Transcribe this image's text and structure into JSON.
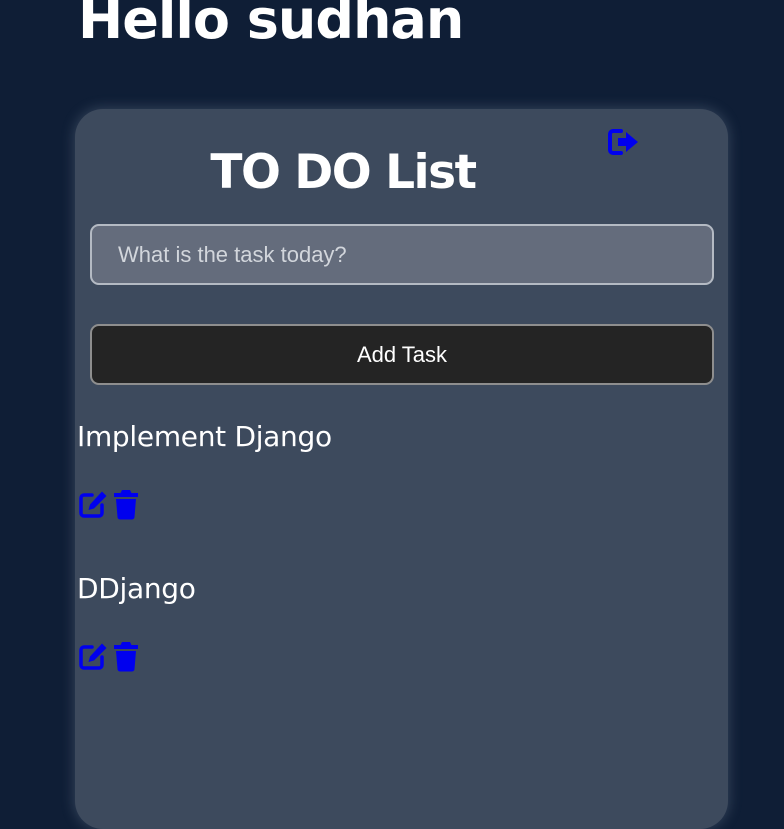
{
  "header": {
    "greeting": "Hello sudhan"
  },
  "card": {
    "title": "TO DO List",
    "logout_icon": "sign-out-icon",
    "task_input": {
      "placeholder": "What is the task today?",
      "value": ""
    },
    "add_button_label": "Add Task",
    "tasks": [
      {
        "title": "Implement Django",
        "edit_icon": "edit-icon",
        "delete_icon": "trash-icon"
      },
      {
        "title": "DDjango",
        "edit_icon": "edit-icon",
        "delete_icon": "trash-icon"
      }
    ]
  },
  "colors": {
    "page_background": "#0f1e36",
    "card_background": "#3d4a5d",
    "input_background": "#646c7c",
    "button_background": "#242424",
    "icon_color": "#0000ee",
    "text_color": "#ffffff"
  }
}
